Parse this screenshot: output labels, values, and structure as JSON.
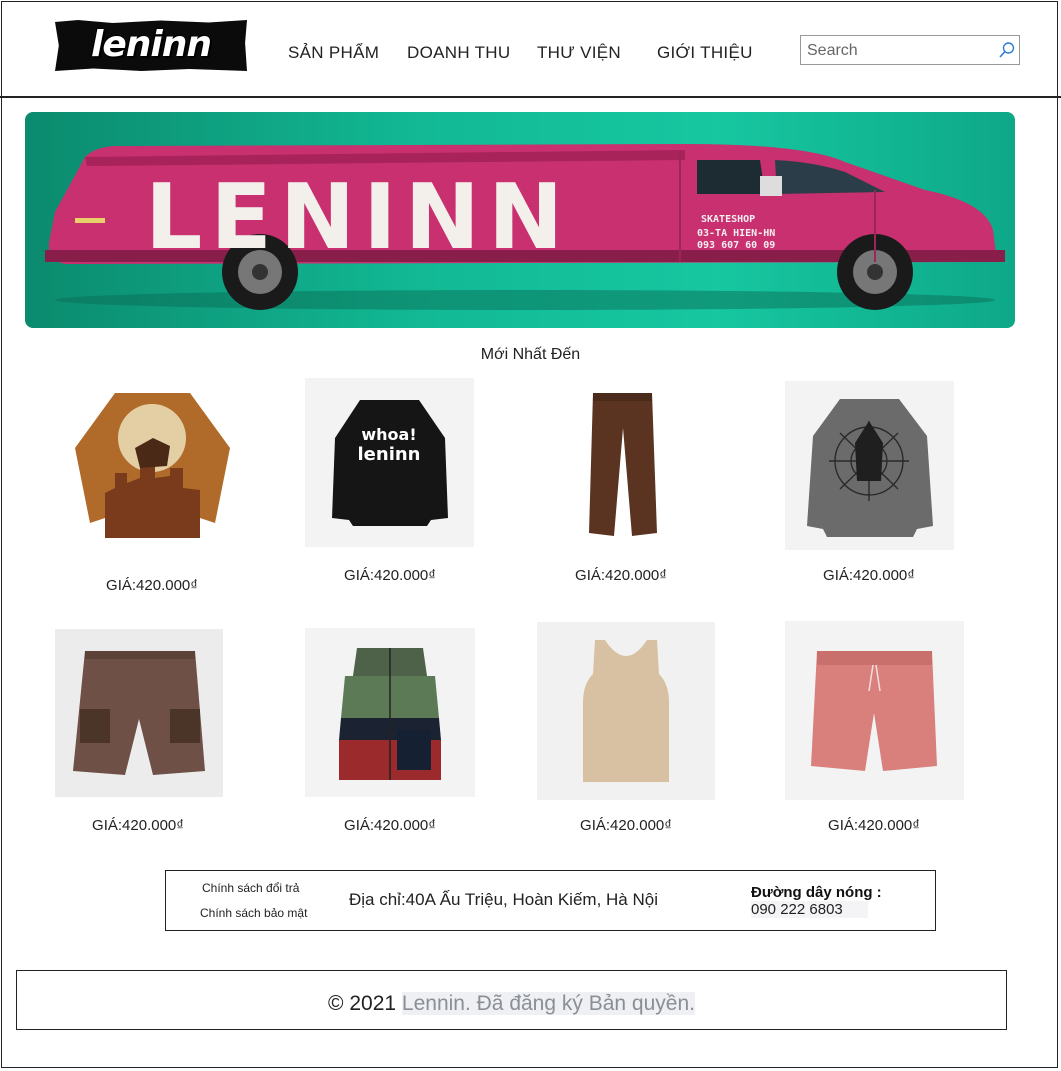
{
  "header": {
    "logo_text": "leninn",
    "nav": [
      "SẢN PHẨM",
      "DOANH THU",
      "THƯ VIỆN",
      "GIỚI THIỆU"
    ],
    "search_placeholder": "Search"
  },
  "banner": {
    "brand_text": "LENINN",
    "van_line1": "SKATESHOP",
    "van_line2": "03-TA HIEN-HN",
    "van_line3": "093 607 60 09"
  },
  "section_title": "Mới Nhất Đến",
  "products": [
    {
      "price": "GIÁ:420.000₫",
      "icon": "brown-city-sweater-icon"
    },
    {
      "price": "GIÁ:420.000₫",
      "icon": "black-whoa-sweatshirt-icon",
      "print": "whoa!\nleninn"
    },
    {
      "price": "GIÁ:420.000₫",
      "icon": "brown-pants-icon"
    },
    {
      "price": "GIÁ:420.000₫",
      "icon": "grey-spider-sweater-icon"
    },
    {
      "price": "GIÁ:420.000₫",
      "icon": "cargo-shorts-icon"
    },
    {
      "price": "GIÁ:420.000₫",
      "icon": "colorblock-vest-icon"
    },
    {
      "price": "GIÁ:420.000₫",
      "icon": "beige-tank-top-icon"
    },
    {
      "price": "GIÁ:420.000₫",
      "icon": "pink-shorts-icon"
    }
  ],
  "info": {
    "policy_return": "Chính sách đổi trả",
    "policy_warranty": "Chính sách bảo mật",
    "address": "Địa chỉ:40A Ấu Triệu, Hoàn Kiếm, Hà Nội",
    "hotline_label": "Đường dây nóng :",
    "hotline_number": "090 222 6803"
  },
  "footer": {
    "copyright_symbol": "© 2021",
    "copyright_text": "Lennin. Đã đăng ký Bản quyền."
  }
}
